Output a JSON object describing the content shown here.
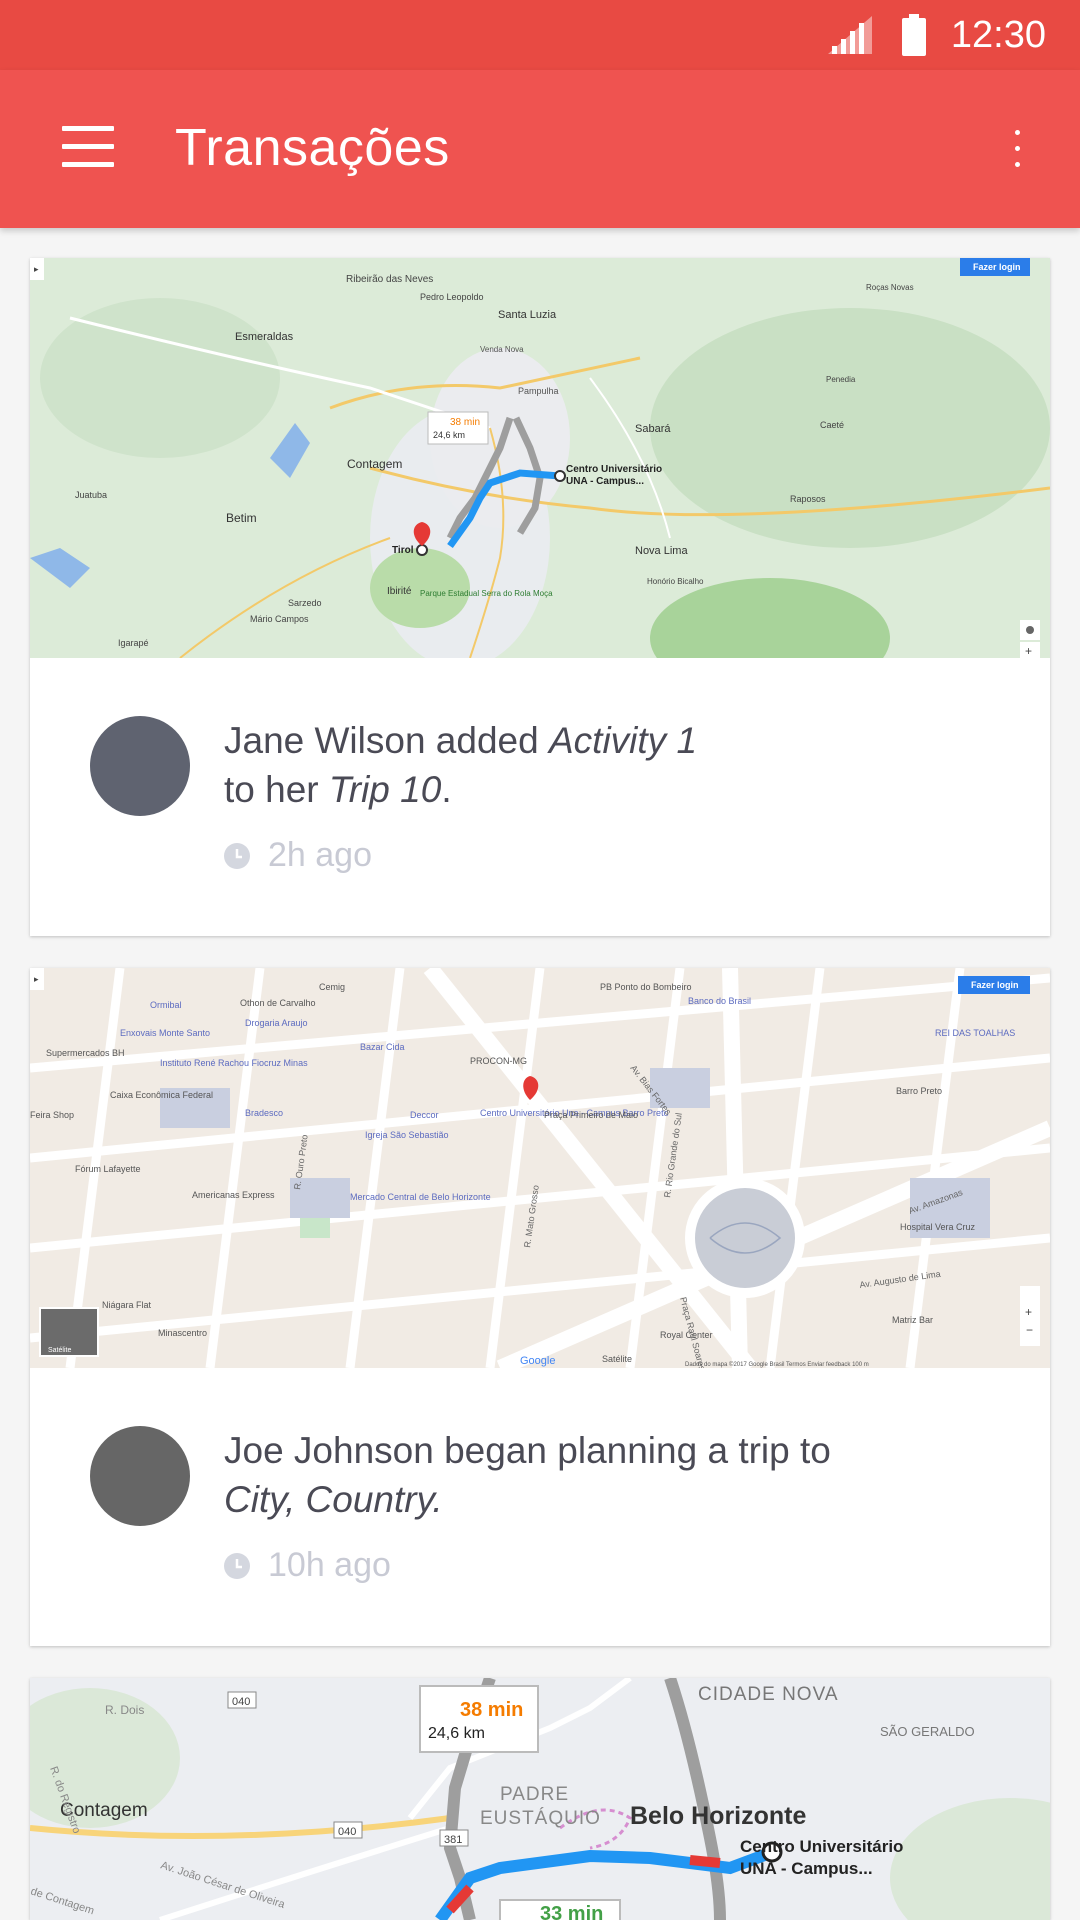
{
  "status_bar": {
    "time": "12:30",
    "signal_icon": "signal-icon",
    "battery_icon": "battery-icon"
  },
  "app_bar": {
    "title": "Transações",
    "menu_icon": "hamburger-menu-icon",
    "overflow_icon": "more-vert-icon"
  },
  "colors": {
    "status_bar": "#e84a43",
    "app_bar": "#ef5350",
    "route": "#2196f3",
    "pin": "#e53935"
  },
  "cards": [
    {
      "map": {
        "login_button": "Fazer login",
        "route_time": "38 min",
        "route_distance": "24,6 km",
        "destination": "Centro Universitário",
        "destination_2": "UNA - Campus...",
        "origin": "Tirol",
        "places": [
          "Ribeirão das Neves",
          "Santa Luzia",
          "Esmeraldas",
          "Contagem",
          "Sabará",
          "Betim",
          "Nova Lima",
          "Ibirité",
          "Pampulha",
          "Venda Nova",
          "Juatuba",
          "Sarzedo",
          "Mário Campos",
          "Igarapé",
          "Pedro Leopoldo",
          "Caeté",
          "Raposos",
          "Honório Bicalho",
          "Parque Estadual Serra do Rola Moça",
          "Roças Novas",
          "Penedia"
        ]
      },
      "user": "Jane Wilson",
      "text_1": " added ",
      "item": "Activity 1",
      "text_2": "to her ",
      "trip": "Trip 10",
      "text_3": ".",
      "time_ago": "2h ago",
      "avatar_color": "#5f6370"
    },
    {
      "map": {
        "login_button": "Fazer login",
        "places": [
          "Cemig",
          "PB Ponto do Bombeiro",
          "Banco do Brasil",
          "Ormibal",
          "Othon de Carvalho",
          "Drogaria Araujo",
          "Enxovais Monte Santo",
          "Bazar Cida",
          "Supermercados BH",
          "Pro Labore Cursos Jurídicos",
          "REI DAS TOALHAS",
          "PROCON-MG",
          "Instituto René Rachou Fiocruz Minas",
          "Caixa Econômica Federal",
          "Bradesco",
          "Deccor",
          "Centro Universitário Una - Campus Barro Preto",
          "Praça Primeiro de Maio",
          "Barro Preto",
          "Feira Shop",
          "Igreja São Sebastião",
          "Fórum Lafayette",
          "Americanas Express",
          "Mercado Central de Belo Horizonte",
          "Hospital Vera Cruz",
          "Niágara Flat",
          "Minascentro",
          "Matriz Bar",
          "Royal Center",
          "Satélite"
        ],
        "streets": [
          "Av. Amazonas",
          "Av. Augusto de Lima",
          "R. Mato Grosso",
          "R. Rio Grande do Sul",
          "Av. Bias Fortes",
          "Praça Raul Soares",
          "R. Ouro Preto"
        ],
        "footer": "Dados do mapa ©2017 Google   Brasil   Termos   Enviar feedback   100 m"
      },
      "user": "Joe Johnson",
      "text_1": " began planning a trip to",
      "item": "City, Country.",
      "time_ago": "10h ago",
      "avatar_color": "#666666"
    },
    {
      "map": {
        "route_time": "38 min",
        "route_distance": "24,6 km",
        "alt_time": "33 min",
        "places": [
          "CIDADE NOVA",
          "SÃO GERALDO",
          "Contagem",
          "PADRE",
          "EUSTÁQUIO",
          "Belo Horizonte",
          "Centro Universitário",
          "UNA - Campus..."
        ],
        "roads": [
          "R. Dois",
          "040",
          "381",
          "R. do Registro",
          "Av. João César de Oliveira",
          "de Contagem"
        ]
      }
    }
  ]
}
